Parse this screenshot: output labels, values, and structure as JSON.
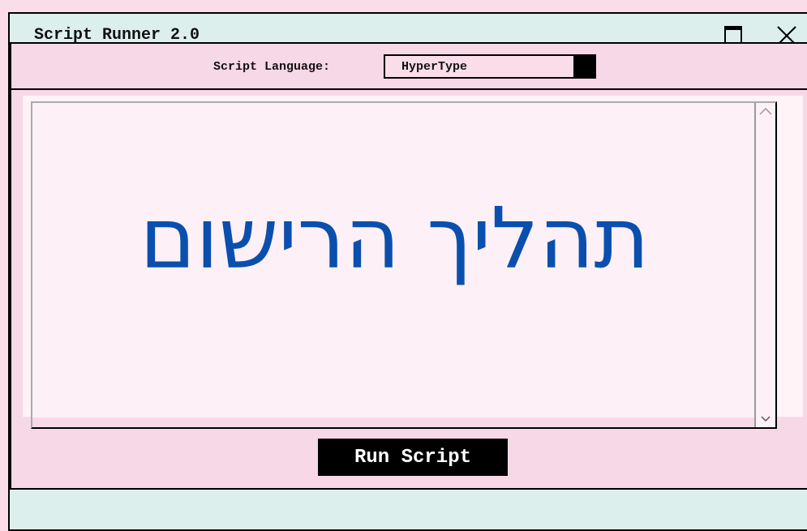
{
  "window": {
    "title": "Script Runner 2.0"
  },
  "toolbar": {
    "language_label": "Script Language:",
    "language_value": "HyperType"
  },
  "editor": {
    "text": "תהליך הרישום"
  },
  "actions": {
    "run_label": "Run Script"
  },
  "icons": {
    "minimize": "minimize-icon",
    "maximize": "maximize-icon",
    "close": "close-icon",
    "dropdown": "dropdown-arrow-icon",
    "scroll_up": "chevron-up-icon",
    "scroll_down": "chevron-down-icon"
  },
  "colors": {
    "page_bg": "#f9dde9",
    "titlebar_bg": "#dcefed",
    "editor_text": "#0b4fae"
  }
}
